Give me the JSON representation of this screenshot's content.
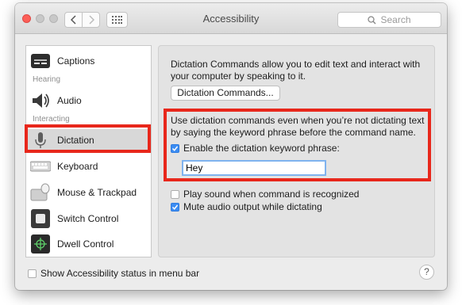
{
  "window": {
    "title": "Accessibility",
    "search_placeholder": "Search"
  },
  "sidebar": {
    "items": [
      {
        "label": "Captions",
        "icon": "captions-icon"
      },
      {
        "label": "Audio",
        "icon": "speaker-icon"
      },
      {
        "label": "Dictation",
        "icon": "microphone-icon",
        "selected": true
      },
      {
        "label": "Keyboard",
        "icon": "keyboard-icon"
      },
      {
        "label": "Mouse & Trackpad",
        "icon": "mouse-trackpad-icon"
      },
      {
        "label": "Switch Control",
        "icon": "switch-control-icon"
      },
      {
        "label": "Dwell Control",
        "icon": "dwell-control-icon"
      }
    ],
    "headers": {
      "hearing": "Hearing",
      "interacting": "Interacting"
    }
  },
  "main": {
    "intro": "Dictation Commands allow you to edit text and interact with your computer by speaking to it.",
    "commands_button": "Dictation Commands...",
    "keyword_description": "Use dictation commands even when you’re not dictating text by saying the keyword phrase before the command name.",
    "enable_keyword_label": "Enable the dictation keyword phrase:",
    "enable_keyword_checked": true,
    "keyword_value": "Hey",
    "play_sound_label": "Play sound when command is recognized",
    "play_sound_checked": false,
    "mute_label": "Mute audio output while dictating",
    "mute_checked": true
  },
  "footer": {
    "show_status_label": "Show Accessibility status in menu bar",
    "show_status_checked": false,
    "help": "?"
  },
  "colors": {
    "highlight": "#e8271b",
    "checkbox_on": "#3b8cf2"
  }
}
